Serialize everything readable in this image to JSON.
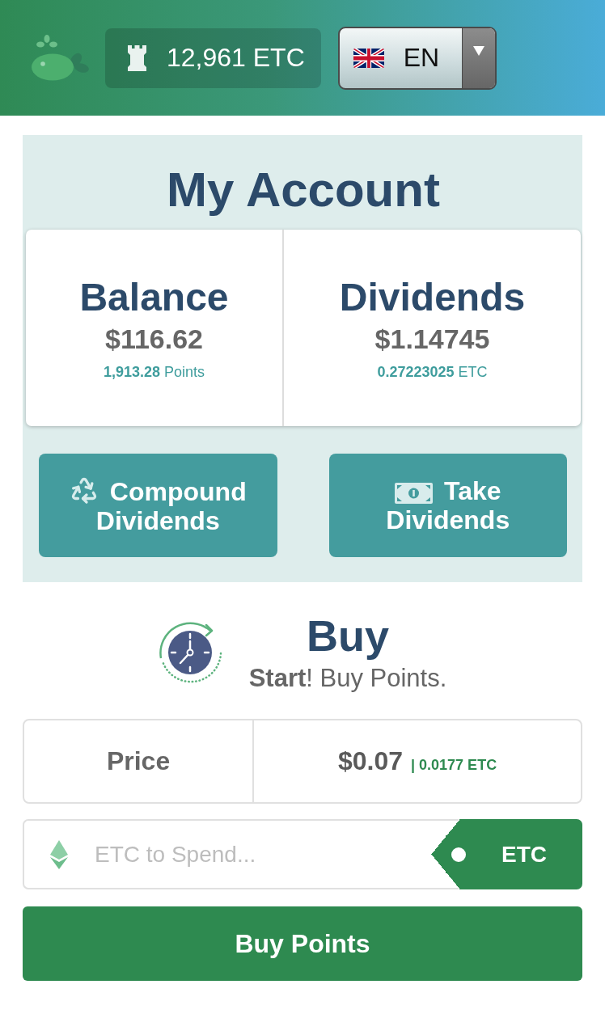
{
  "header": {
    "balance": "12,961 ETC",
    "language": "EN"
  },
  "account": {
    "title": "My Account",
    "stats": [
      {
        "label": "Balance",
        "value": "$116.62",
        "sub": "**1,913.28** Points"
      },
      {
        "label": "Dividends",
        "value": "$1.14745",
        "sub": "**0.27223025** ETC"
      }
    ],
    "actions": [
      {
        "kind": "compound",
        "label": "Compound Dividends"
      },
      {
        "kind": "take",
        "label": "Take Dividends"
      }
    ]
  },
  "buy": {
    "title": "Buy",
    "subtitle": "**Start**! Buy Points.",
    "price": {
      "label": "Price",
      "value": "$0.07",
      "secondary": "| 0.0177 ETC"
    },
    "input": {
      "placeholder": "ETC to Spend...",
      "currency": "ETC"
    },
    "button": "Buy Points"
  }
}
